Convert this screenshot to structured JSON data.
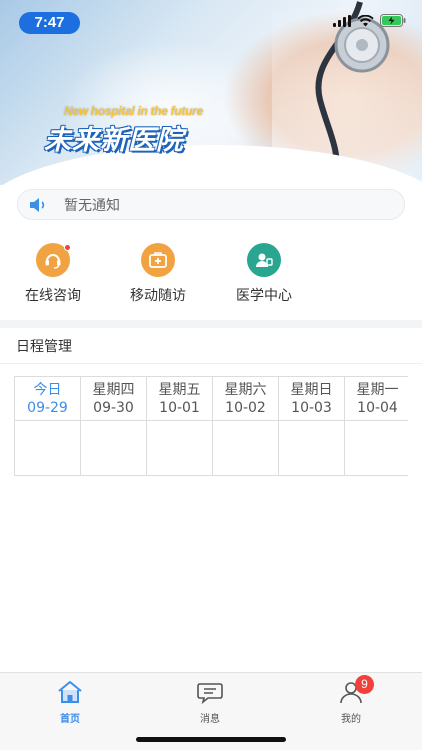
{
  "status_bar": {
    "time": "7:47",
    "icons": [
      "signal-icon",
      "wifi-icon",
      "battery-charging-icon"
    ]
  },
  "banner": {
    "subtitle": "New hospital in the future",
    "title": "未来新医院"
  },
  "notice": {
    "icon": "speaker-icon",
    "text": "暂无通知"
  },
  "quick_actions": [
    {
      "label": "在线咨询",
      "icon": "headset-icon",
      "color": "#f2a341",
      "has_dot": true
    },
    {
      "label": "移动随访",
      "icon": "medical-kit-icon",
      "color": "#f2a341",
      "has_dot": false
    },
    {
      "label": "医学中心",
      "icon": "doctor-icon",
      "color": "#2aa58f",
      "has_dot": false
    }
  ],
  "schedule": {
    "title": "日程管理",
    "days": [
      {
        "day": "今日",
        "date": "09-29",
        "today": true
      },
      {
        "day": "星期四",
        "date": "09-30",
        "today": false
      },
      {
        "day": "星期五",
        "date": "10-01",
        "today": false
      },
      {
        "day": "星期六",
        "date": "10-02",
        "today": false
      },
      {
        "day": "星期日",
        "date": "10-03",
        "today": false
      },
      {
        "day": "星期一",
        "date": "10-04",
        "today": false
      }
    ]
  },
  "tabbar": {
    "tabs": [
      {
        "label": "首页",
        "icon": "home-icon",
        "active": true
      },
      {
        "label": "消息",
        "icon": "chat-icon",
        "active": false
      },
      {
        "label": "我的",
        "icon": "user-icon",
        "active": false,
        "badge": "9"
      }
    ]
  },
  "colors": {
    "accent": "#3c8ee8",
    "orange": "#f2a341",
    "teal": "#2aa58f",
    "badge": "#f0413c"
  }
}
